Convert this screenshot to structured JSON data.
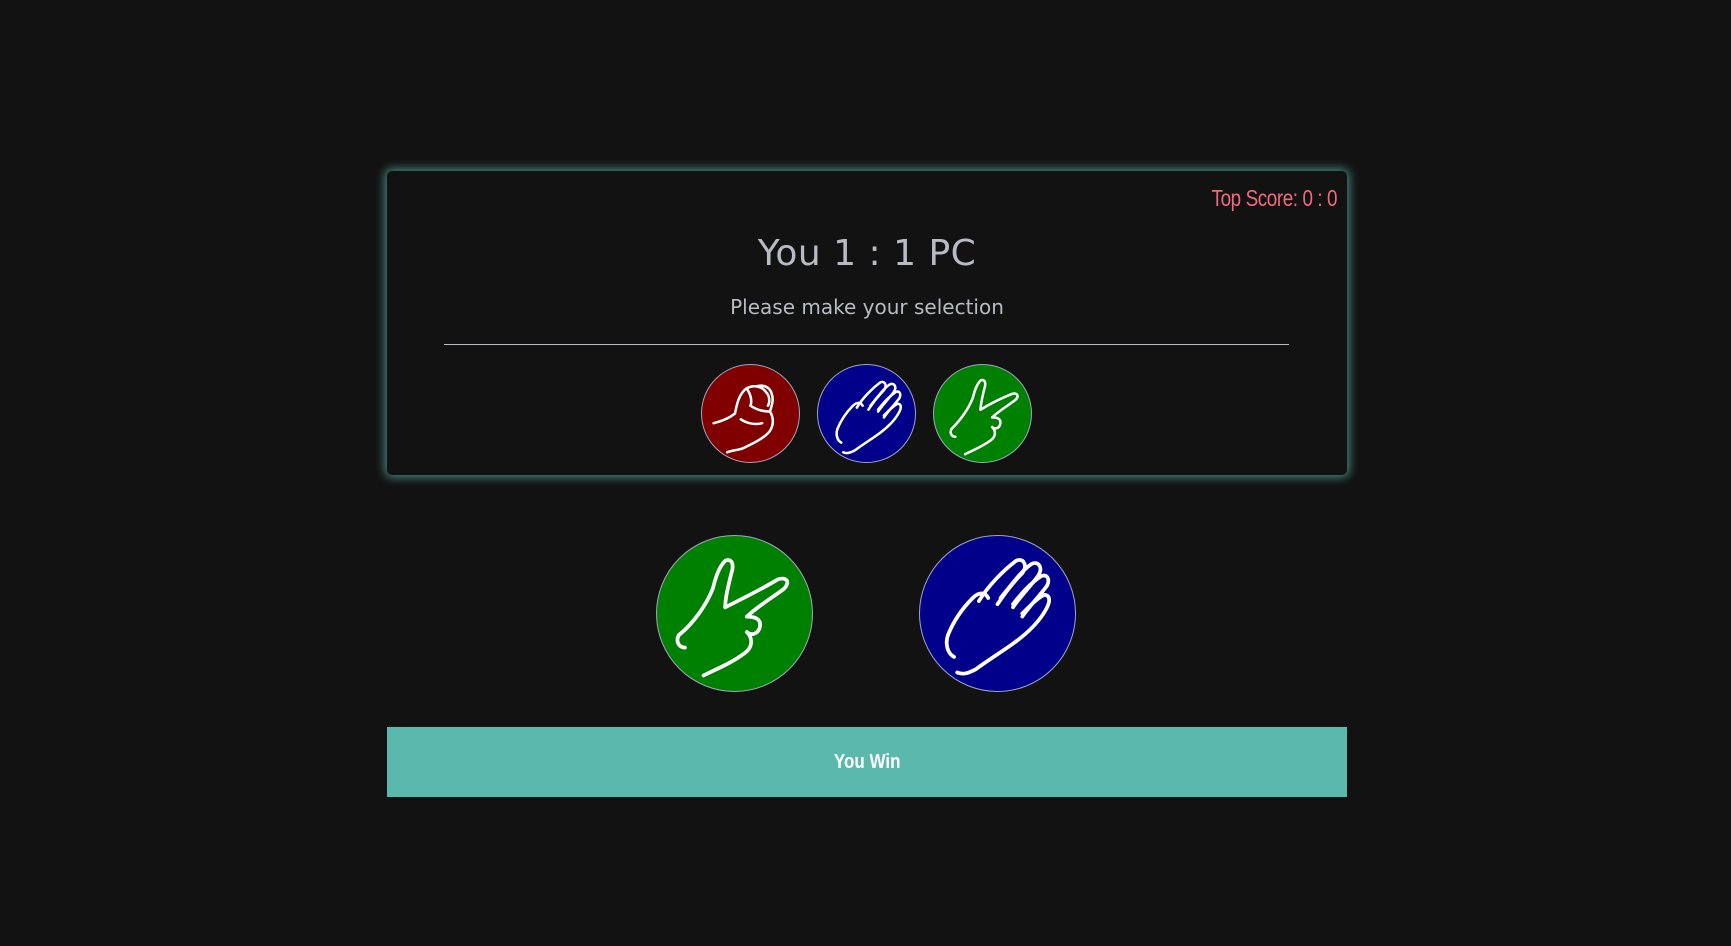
{
  "scoreboard": {
    "top_score": "Top Score: 0 : 0",
    "scoreline": "You 1 : 1 PC",
    "prompt": "Please make your selection"
  },
  "choices": [
    {
      "name": "rock",
      "icon": "rock-fist-icon",
      "color": "#800000"
    },
    {
      "name": "paper",
      "icon": "paper-hand-icon",
      "color": "#00008b"
    },
    {
      "name": "scissors",
      "icon": "scissors-hand-icon",
      "color": "#008000"
    }
  ],
  "round": {
    "player_hand": {
      "name": "scissors",
      "icon": "scissors-hand-icon",
      "color": "#008000"
    },
    "pc_hand": {
      "name": "paper",
      "icon": "paper-hand-icon",
      "color": "#00008b"
    }
  },
  "result": {
    "text": "You Win",
    "color": "#5bb8ad"
  },
  "theme": {
    "background": "#121212",
    "top_score_color": "#f06a7d",
    "text_color": "#b9bbc4"
  }
}
